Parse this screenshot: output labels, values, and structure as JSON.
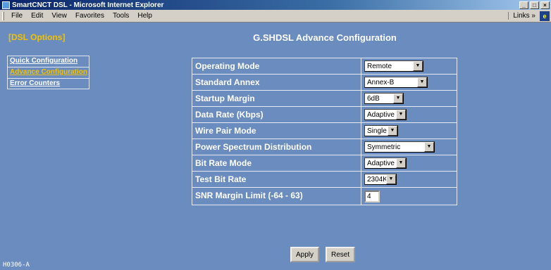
{
  "window": {
    "title": "SmartCNCT DSL - Microsoft Internet Explorer"
  },
  "menubar": {
    "items": [
      "File",
      "Edit",
      "View",
      "Favorites",
      "Tools",
      "Help"
    ],
    "links_label": "Links »"
  },
  "sidebar": {
    "header": "[DSL Options]",
    "items": [
      {
        "label": "Quick Configuration",
        "active": false
      },
      {
        "label": "Advance Configuration",
        "active": true
      },
      {
        "label": "Error Counters",
        "active": false
      }
    ]
  },
  "main": {
    "title": "G.SHDSL Advance Configuration",
    "rows": [
      {
        "label": "Operating Mode",
        "type": "select",
        "value": "Remote"
      },
      {
        "label": "Standard Annex",
        "type": "select",
        "value": "Annex-B"
      },
      {
        "label": "Startup Margin",
        "type": "select",
        "value": "6dB"
      },
      {
        "label": "Data Rate (Kbps)",
        "type": "select",
        "value": "Adaptive"
      },
      {
        "label": "Wire Pair Mode",
        "type": "select",
        "value": "Single"
      },
      {
        "label": "Power Spectrum Distribution",
        "type": "select",
        "value": "Symmetric"
      },
      {
        "label": "Bit Rate Mode",
        "type": "select",
        "value": "Adaptive"
      },
      {
        "label": "Test Bit Rate",
        "type": "select",
        "value": "2304K"
      },
      {
        "label": "SNR Margin Limit (-64 - 63)",
        "type": "input",
        "value": "4"
      }
    ],
    "apply_label": "Apply",
    "reset_label": "Reset"
  },
  "footer": {
    "code": "H0306-A"
  }
}
